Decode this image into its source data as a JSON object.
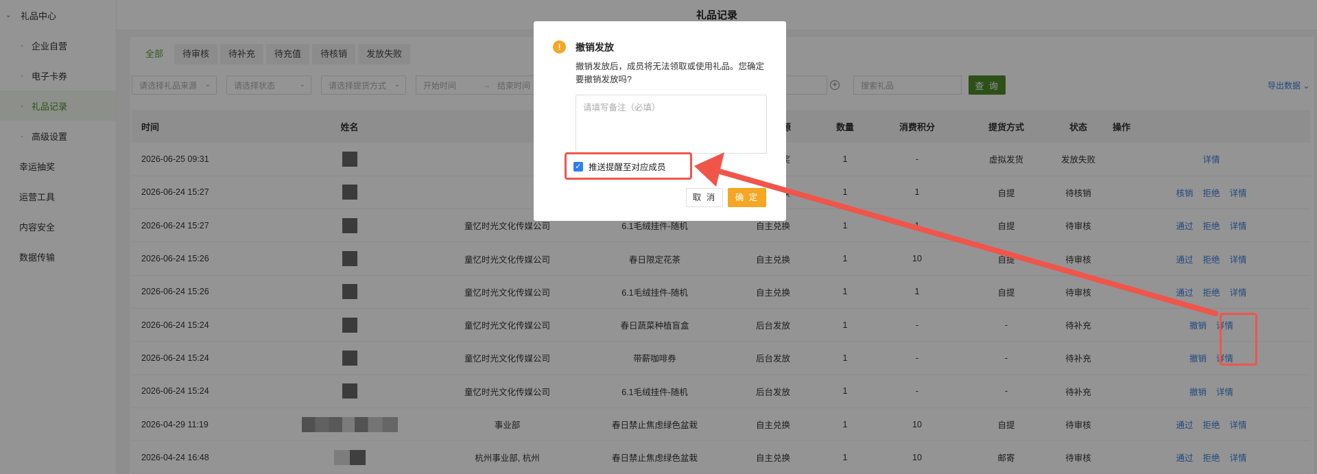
{
  "sidebar": {
    "group": "礼品中心",
    "sub_items": [
      "企业自营",
      "电子卡券",
      "礼品记录",
      "高级设置"
    ],
    "items": [
      "幸运抽奖",
      "运营工具",
      "内容安全",
      "数据传输"
    ]
  },
  "header": {
    "title": "礼品记录"
  },
  "tabs": [
    "全部",
    "待审核",
    "待补充",
    "待充值",
    "待核销",
    "发放失败"
  ],
  "filters": {
    "source_placeholder": "请选择礼品来源",
    "status_placeholder": "请选择状态",
    "delivery_placeholder": "请选择提货方式",
    "start_placeholder": "开始时间",
    "end_placeholder": "结束时间",
    "search_placeholder": "搜索礼品",
    "query_label": "查 询",
    "export_label": "导出数据 ⌄"
  },
  "table": {
    "columns": [
      "时间",
      "姓名",
      "",
      "",
      "礼品来源",
      "数量",
      "消费积分",
      "提货方式",
      "状态",
      "操作"
    ],
    "rows": [
      {
        "time": "2026-06-25 09:31",
        "dept": "",
        "gift": "券",
        "source": "幸运抽奖",
        "qty": "1",
        "points": "-",
        "delivery": "虚拟发货",
        "status": "发放失败",
        "actions": [
          "详情"
        ]
      },
      {
        "time": "2026-06-24 15:27",
        "dept": "",
        "gift": "",
        "source": "自主兑换",
        "qty": "1",
        "points": "1",
        "delivery": "自提",
        "status": "待核销",
        "actions": [
          "核销",
          "拒绝",
          "详情"
        ]
      },
      {
        "time": "2026-06-24 15:27",
        "dept": "童忆时光文化传媒公司",
        "gift": "6.1毛绒挂件-随机",
        "source": "自主兑换",
        "qty": "1",
        "points": "1",
        "delivery": "自提",
        "status": "待审核",
        "actions": [
          "通过",
          "拒绝",
          "详情"
        ]
      },
      {
        "time": "2026-06-24 15:26",
        "dept": "童忆时光文化传媒公司",
        "gift": "春日限定花茶",
        "source": "自主兑换",
        "qty": "1",
        "points": "10",
        "delivery": "自提",
        "status": "待审核",
        "actions": [
          "通过",
          "拒绝",
          "详情"
        ]
      },
      {
        "time": "2026-06-24 15:26",
        "dept": "童忆时光文化传媒公司",
        "gift": "6.1毛绒挂件-随机",
        "source": "自主兑换",
        "qty": "1",
        "points": "1",
        "delivery": "自提",
        "status": "待审核",
        "actions": [
          "通过",
          "拒绝",
          "详情"
        ]
      },
      {
        "time": "2026-06-24 15:24",
        "dept": "童忆时光文化传媒公司",
        "gift": "春日蔬菜种植盲盒",
        "source": "后台发放",
        "qty": "1",
        "points": "-",
        "delivery": "-",
        "status": "待补充",
        "actions": [
          "撤销",
          "详情"
        ]
      },
      {
        "time": "2026-06-24 15:24",
        "dept": "童忆时光文化传媒公司",
        "gift": "带薪咖啡券",
        "source": "后台发放",
        "qty": "1",
        "points": "-",
        "delivery": "-",
        "status": "待补充",
        "actions": [
          "撤销",
          "详情"
        ]
      },
      {
        "time": "2026-06-24 15:24",
        "dept": "童忆时光文化传媒公司",
        "gift": "6.1毛绒挂件-随机",
        "source": "后台发放",
        "qty": "1",
        "points": "-",
        "delivery": "-",
        "status": "待补充",
        "actions": [
          "撤销",
          "详情"
        ]
      },
      {
        "time": "2026-04-29 11:19",
        "dept": "事业部",
        "gift": "春日禁止焦虑绿色盆栽",
        "source": "自主兑换",
        "qty": "1",
        "points": "10",
        "delivery": "自提",
        "status": "待审核",
        "actions": [
          "通过",
          "拒绝",
          "详情"
        ]
      },
      {
        "time": "2026-04-24 16:48",
        "dept": "杭州事业部, 杭州",
        "gift": "春日禁止焦虑绿色盆栽",
        "source": "自主兑换",
        "qty": "1",
        "points": "10",
        "delivery": "邮寄",
        "status": "待审核",
        "actions": [
          "通过",
          "拒绝",
          "详情"
        ]
      }
    ]
  },
  "modal": {
    "title": "撤销发放",
    "message": "撤销发放后，成员将无法领取或使用礼品。您确定要撤销发放吗?",
    "remark_placeholder": "请填写备注（必填）",
    "checkbox_label": "推送提醒至对应成员",
    "checkbox_checked": true,
    "cancel_label": "取 消",
    "confirm_label": "确 定"
  },
  "colors": {
    "accent": "#4e8a2a",
    "link": "#3a7dd8",
    "warning": "#f5a623",
    "annotation": "#f0554a"
  }
}
